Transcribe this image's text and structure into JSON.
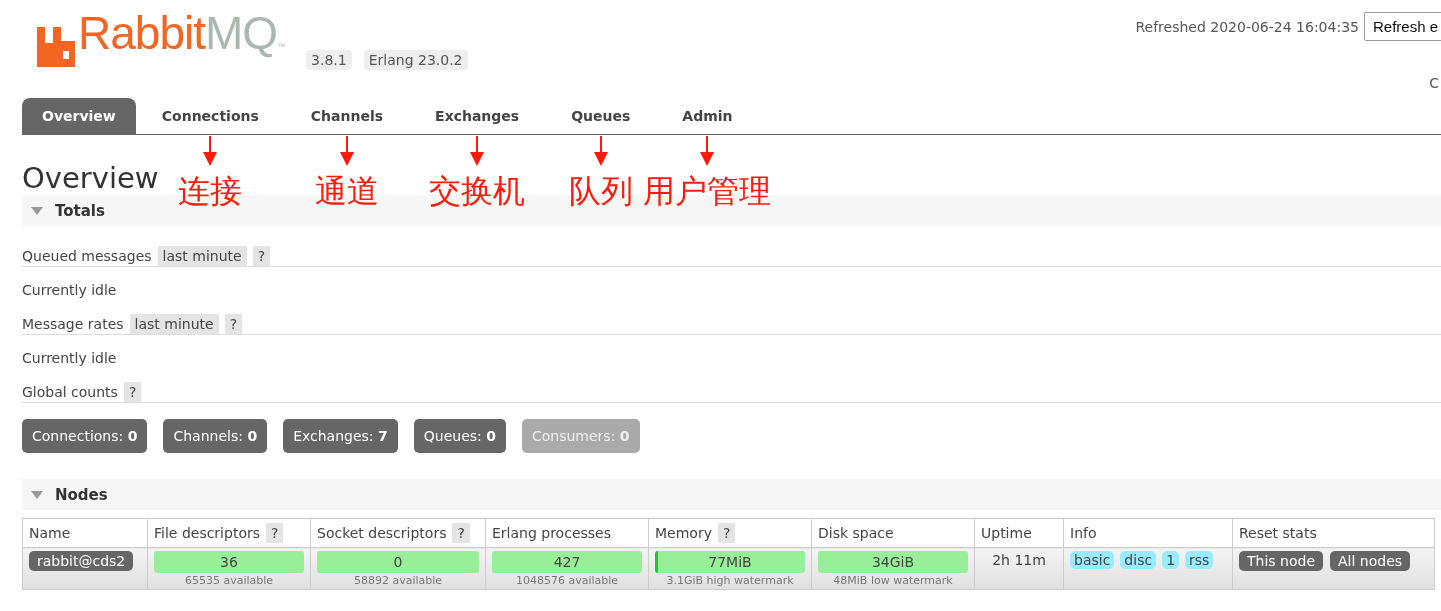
{
  "header": {
    "logo": {
      "brand": "Rabbit",
      "suffix": "MQ",
      "tm": "™"
    },
    "versions": [
      "3.8.1",
      "Erlang 23.0.2"
    ],
    "refreshed": "Refreshed 2020-06-24 16:04:35",
    "refresh_select": "Refresh e",
    "corner_text": "C"
  },
  "tabs": [
    {
      "label": "Overview",
      "selected": true
    },
    {
      "label": "Connections",
      "selected": false,
      "annotation": "连接"
    },
    {
      "label": "Channels",
      "selected": false,
      "annotation": "通道"
    },
    {
      "label": "Exchanges",
      "selected": false,
      "annotation": "交换机"
    },
    {
      "label": "Queues",
      "selected": false,
      "annotation": "队列"
    },
    {
      "label": "Admin",
      "selected": false,
      "annotation": "用户管理"
    }
  ],
  "page_title": "Overview",
  "totals": {
    "title": "Totals",
    "expanded": true,
    "items": [
      {
        "kind": "heading",
        "label": "Queued messages",
        "option": "last minute",
        "help": "?"
      },
      {
        "kind": "note",
        "label": "Currently idle"
      },
      {
        "kind": "heading",
        "label": "Message rates",
        "option": "last minute",
        "help": "?"
      },
      {
        "kind": "note",
        "label": "Currently idle"
      },
      {
        "kind": "heading",
        "label": "Global counts",
        "help": "?"
      }
    ],
    "counts": [
      {
        "label": "Connections: **0**",
        "disabled": false
      },
      {
        "label": "Channels: **0**",
        "disabled": false
      },
      {
        "label": "Exchanges: **7**",
        "disabled": false
      },
      {
        "label": "Queues: **0**",
        "disabled": false
      },
      {
        "label": "Consumers: **0**",
        "disabled": true
      }
    ]
  },
  "nodes": {
    "title": "Nodes",
    "expanded": true,
    "columns": [
      {
        "label": "Name"
      },
      {
        "label": "File descriptors",
        "help": "?"
      },
      {
        "label": "Socket descriptors",
        "help": "?"
      },
      {
        "label": "Erlang processes"
      },
      {
        "label": "Memory",
        "help": "?"
      },
      {
        "label": "Disk space"
      },
      {
        "label": "Uptime"
      },
      {
        "label": "Info"
      },
      {
        "label": "Reset stats"
      }
    ],
    "rows": [
      {
        "name": "rabbit@cds2",
        "file_descriptors": {
          "value": "36",
          "detail": "65535 available"
        },
        "socket_descriptors": {
          "value": "0",
          "detail": "58892 available"
        },
        "erlang_processes": {
          "value": "427",
          "detail": "1048576 available"
        },
        "memory": {
          "value": "77MiB",
          "detail": "3.1GiB high watermark",
          "level": 0.02
        },
        "disk_space": {
          "value": "34GiB",
          "detail": "48MiB low watermark"
        },
        "uptime": "2h 11m",
        "info": [
          "basic",
          "disc",
          "1",
          "rss"
        ],
        "reset_buttons": [
          "This node",
          "All nodes"
        ]
      }
    ]
  }
}
